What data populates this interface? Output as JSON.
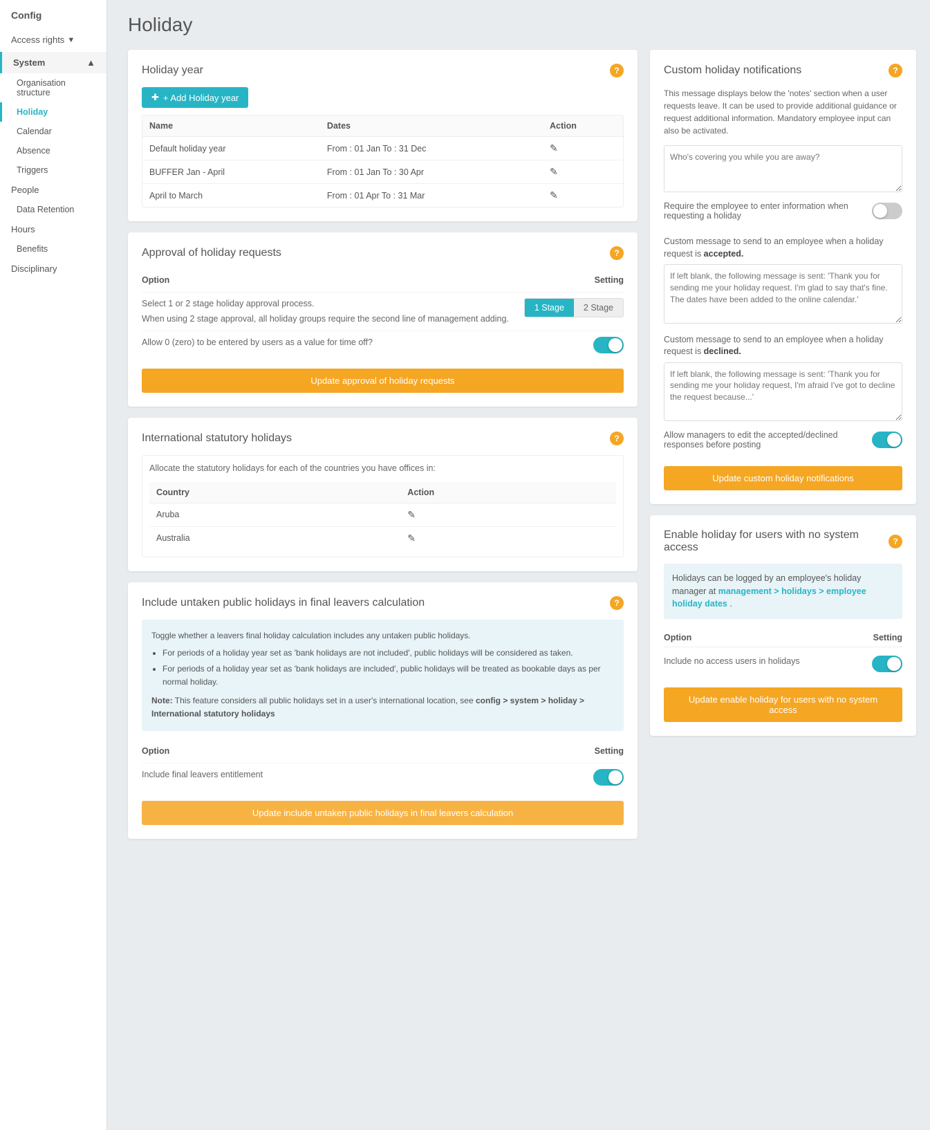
{
  "sidebar": {
    "config_label": "Config",
    "access_rights_label": "Access rights",
    "system_label": "System",
    "system_arrow": "▲",
    "access_arrow": "▼",
    "items": [
      {
        "label": "Organisation structure",
        "active": false
      },
      {
        "label": "Holiday",
        "active": true
      },
      {
        "label": "Calendar",
        "active": false
      },
      {
        "label": "Absence",
        "active": false
      },
      {
        "label": "Triggers",
        "active": false
      },
      {
        "label": "People",
        "active": false
      },
      {
        "label": "Data Retention",
        "active": false
      },
      {
        "label": "Hours",
        "active": false
      },
      {
        "label": "Benefits",
        "active": false
      },
      {
        "label": "Disciplinary",
        "active": false
      }
    ]
  },
  "page": {
    "title": "Holiday"
  },
  "holiday_year": {
    "title": "Holiday year",
    "add_btn": "+ Add Holiday year",
    "columns": [
      "Name",
      "Dates",
      "Action"
    ],
    "rows": [
      {
        "name": "Default holiday year",
        "dates": "From : 01 Jan  To : 31 Dec"
      },
      {
        "name": "BUFFER Jan - April",
        "dates": "From : 01 Jan  To : 30 Apr"
      },
      {
        "name": "April to March",
        "dates": "From : 01 Apr  To : 31 Mar"
      }
    ]
  },
  "approval": {
    "title": "Approval of holiday requests",
    "option_label": "Option",
    "setting_label": "Setting",
    "row1_text": "Select 1 or 2 stage holiday approval process.",
    "row2_text": "When using 2 stage approval, all holiday groups require the second line of management adding.",
    "stage1_label": "1 Stage",
    "stage2_label": "2 Stage",
    "row3_text": "Allow 0 (zero) to be entered by users as a value for time off?",
    "update_btn": "Update approval of holiday requests"
  },
  "international": {
    "title": "International statutory holidays",
    "info_text": "Allocate the statutory holidays for each of the countries you have offices in:",
    "columns": [
      "Country",
      "Action"
    ],
    "rows": [
      {
        "country": "Aruba"
      },
      {
        "country": "Australia"
      }
    ]
  },
  "untaken": {
    "title": "Include untaken public holidays in final leavers calculation",
    "info_line1": "Toggle whether a leavers final holiday calculation includes any untaken public holidays.",
    "bullet1": "For periods of a holiday year set as 'bank holidays are not included', public holidays will be considered as taken.",
    "bullet2": "For periods of a holiday year set as 'bank holidays are included', public holidays will be treated as bookable days as per normal holiday.",
    "note_prefix": "Note:",
    "note_text": " This feature considers all public holidays set in a user's international location, see ",
    "note_link": "config > system > holiday > International statutory holidays",
    "option_label": "Option",
    "setting_label": "Setting",
    "row_text": "Include final leavers entitlement",
    "update_btn": "Update include untaken public holidays in final leavers calculation"
  },
  "custom_notifications": {
    "title": "Custom holiday notifications",
    "info_text": "This message displays below the 'notes' section when a user requests leave. It can be used to provide additional guidance or request additional information. Mandatory employee input can also be activated.",
    "textarea1_placeholder": "Who's covering you while you are away?",
    "toggle1_label": "Require the employee to enter information when requesting a holiday",
    "accepted_label_prefix": "Custom message to send to an employee when a holiday request is ",
    "accepted_label_strong": "accepted.",
    "accepted_placeholder": "If left blank, the following message is sent: 'Thank you for sending me your holiday request. I'm glad to say that's fine. The dates have been added to the online calendar.'",
    "declined_label_prefix": "Custom message to send to an employee when a holiday request is ",
    "declined_label_strong": "declined.",
    "declined_placeholder": "If left blank, the following message is sent: 'Thank you for sending me your holiday request, I'm afraid I've got to decline the request because...'",
    "toggle2_label": "Allow managers to edit the accepted/declined responses before posting",
    "update_btn": "Update custom holiday notifications"
  },
  "enable_holiday": {
    "title": "Enable holiday for users with no system access",
    "info_text": "Holidays can be logged by an employee's holiday manager at ",
    "info_link": "management > holidays > employee holiday dates",
    "info_text2": ".",
    "option_label": "Option",
    "setting_label": "Setting",
    "row_text": "Include no access users in holidays",
    "update_btn": "Update enable holiday for users with no system access"
  },
  "icons": {
    "question_mark": "?",
    "edit": "✎",
    "plus": "+"
  }
}
